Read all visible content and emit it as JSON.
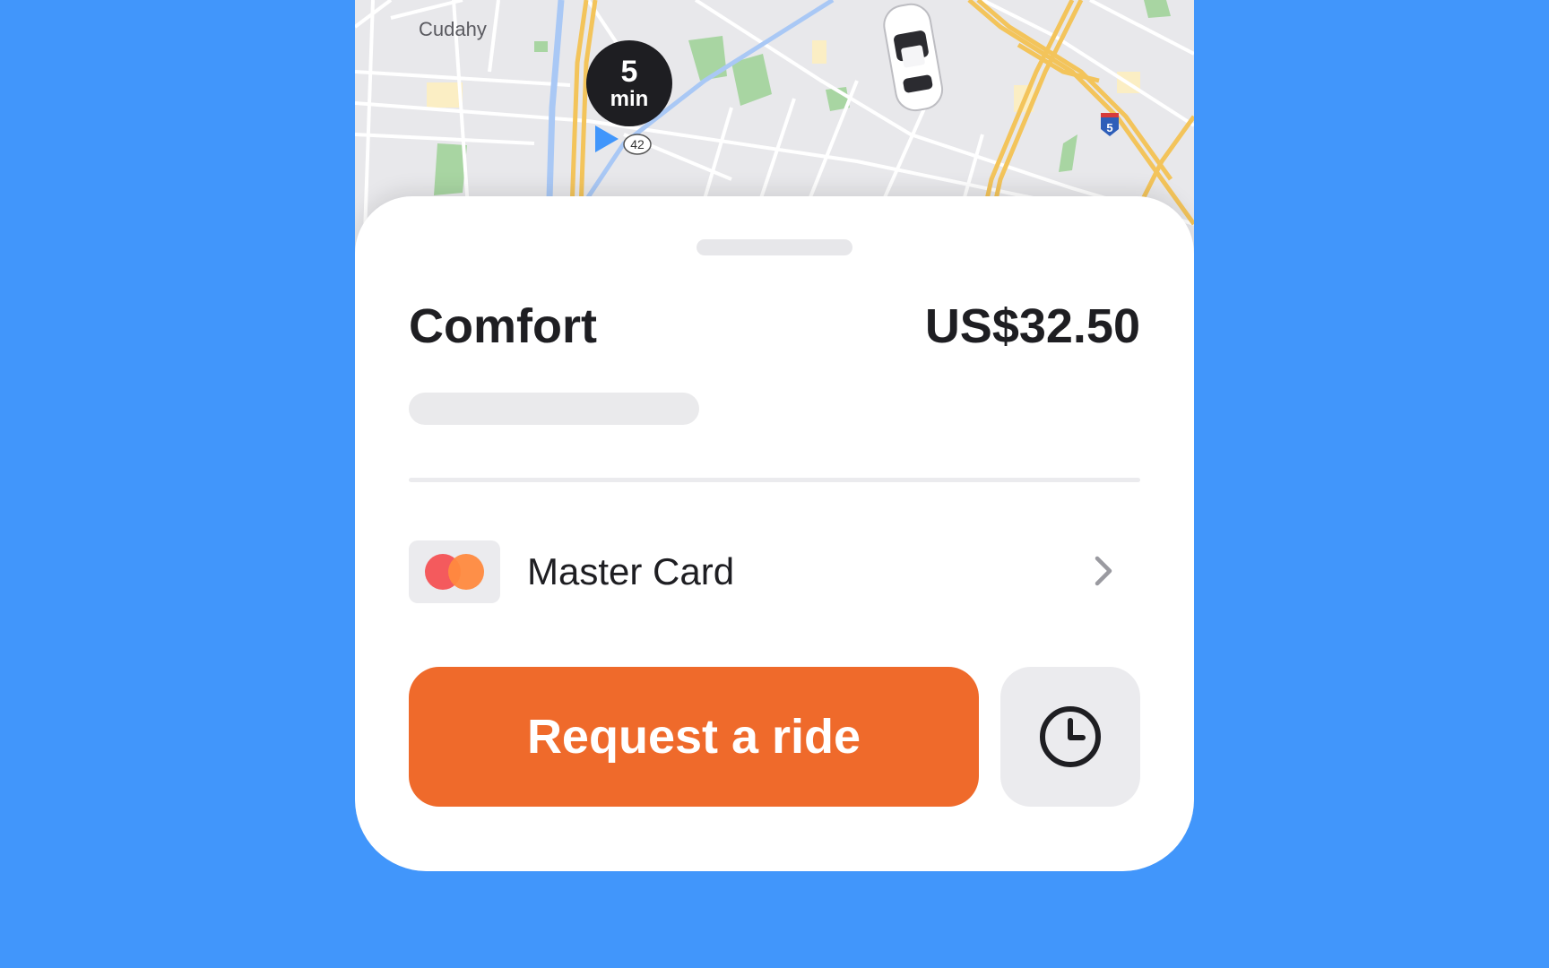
{
  "map": {
    "city_label": "Cudahy",
    "eta": {
      "value": "5",
      "unit": "min"
    },
    "route_shield": "42",
    "interstate_shield": "5"
  },
  "ride": {
    "title": "Comfort",
    "price": "US$32.50"
  },
  "payment": {
    "label": "Master Card",
    "icon": "mastercard-logo"
  },
  "actions": {
    "request_label": "Request a ride",
    "schedule_icon": "clock-icon"
  },
  "colors": {
    "background": "#4196FB",
    "accent": "#EF6A2B",
    "text": "#1E1E22"
  }
}
